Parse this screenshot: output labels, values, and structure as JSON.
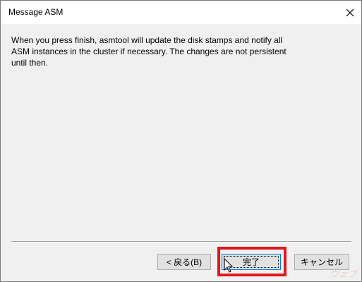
{
  "window": {
    "title": "Message ASM"
  },
  "message": {
    "text": "When you press finish, asmtool will update the disk stamps and notify all\nASM instances in the cluster if necessary. The changes are not persistent\nuntil then."
  },
  "buttons": {
    "back_label": "< 戻る(B)",
    "finish_label": "完了",
    "cancel_label": "キャンセル"
  },
  "icons": {
    "close": "close-icon",
    "cursor": "mouse-pointer-icon"
  },
  "colors": {
    "dialog_bg": "#f0f0f0",
    "titlebar_bg": "#ffffff",
    "highlight": "#e0181e",
    "focus_border": "#0078d7"
  },
  "watermark": {
    "text": "ウェブ"
  }
}
